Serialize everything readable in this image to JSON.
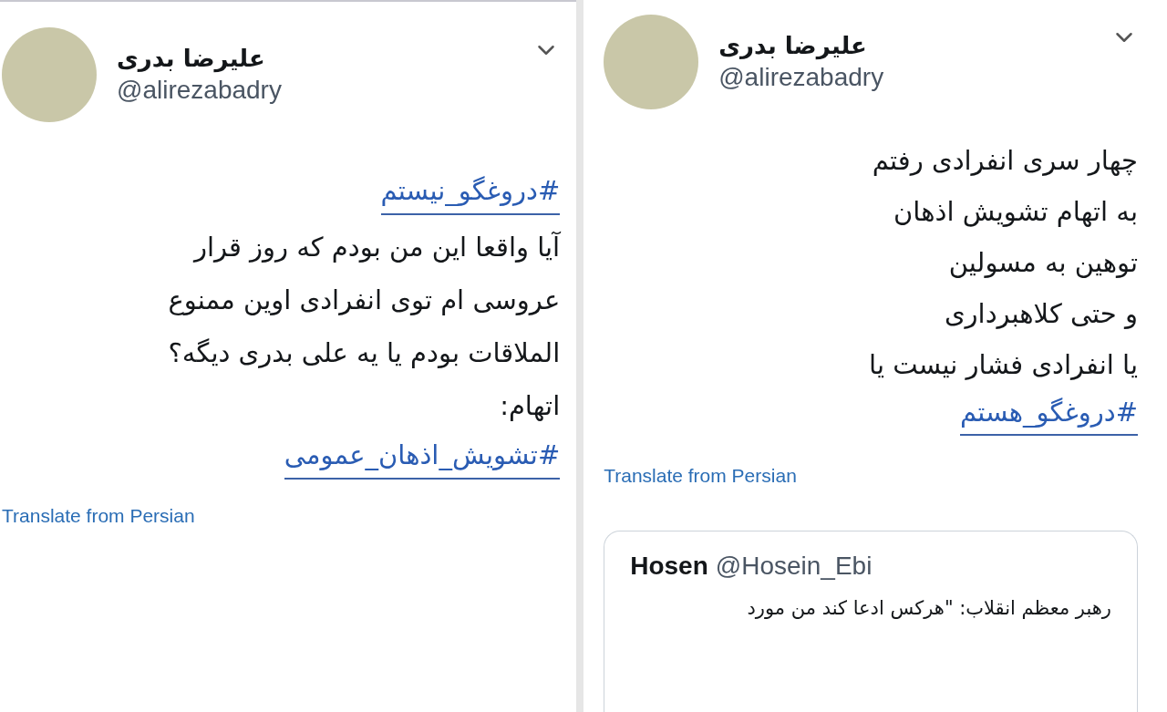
{
  "tweets": [
    {
      "name": "علیرضا بدری",
      "handle": "@alirezabadry",
      "lines": [
        {
          "kind": "hashtag",
          "text": "#دروغگو_نیستم"
        },
        {
          "kind": "text",
          "text": "آیا واقعا این من بودم که روز قرار"
        },
        {
          "kind": "text",
          "text": "عروسی ام توی انفرادی اوین ممنوع"
        },
        {
          "kind": "text",
          "text": "الملاقات بودم یا یه علی بدری دیگه؟"
        },
        {
          "kind": "text",
          "text": "اتهام:"
        },
        {
          "kind": "hashtag",
          "text": "#تشویش_اذهان_عمومی"
        }
      ],
      "translate": "Translate from Persian"
    },
    {
      "name": "علیرضا بدری",
      "handle": "@alirezabadry",
      "lines": [
        {
          "kind": "text",
          "text": "چهار سری انفرادی رفتم"
        },
        {
          "kind": "text",
          "text": "به اتهام تشویش اذهان"
        },
        {
          "kind": "text",
          "text": "توهین به مسولین"
        },
        {
          "kind": "text",
          "text": "و حتی کلاهبرداری"
        },
        {
          "kind": "text",
          "text": "یا انفرادی فشار نیست یا"
        },
        {
          "kind": "hashtag",
          "text": "#دروغگو_هستم"
        }
      ],
      "translate": "Translate from Persian",
      "quote": {
        "name": "Hosen",
        "handle": "@Hosein_Ebi",
        "text": "رهبر معظم انقلاب: \"هرکس ادعا کند من مورد"
      }
    }
  ]
}
